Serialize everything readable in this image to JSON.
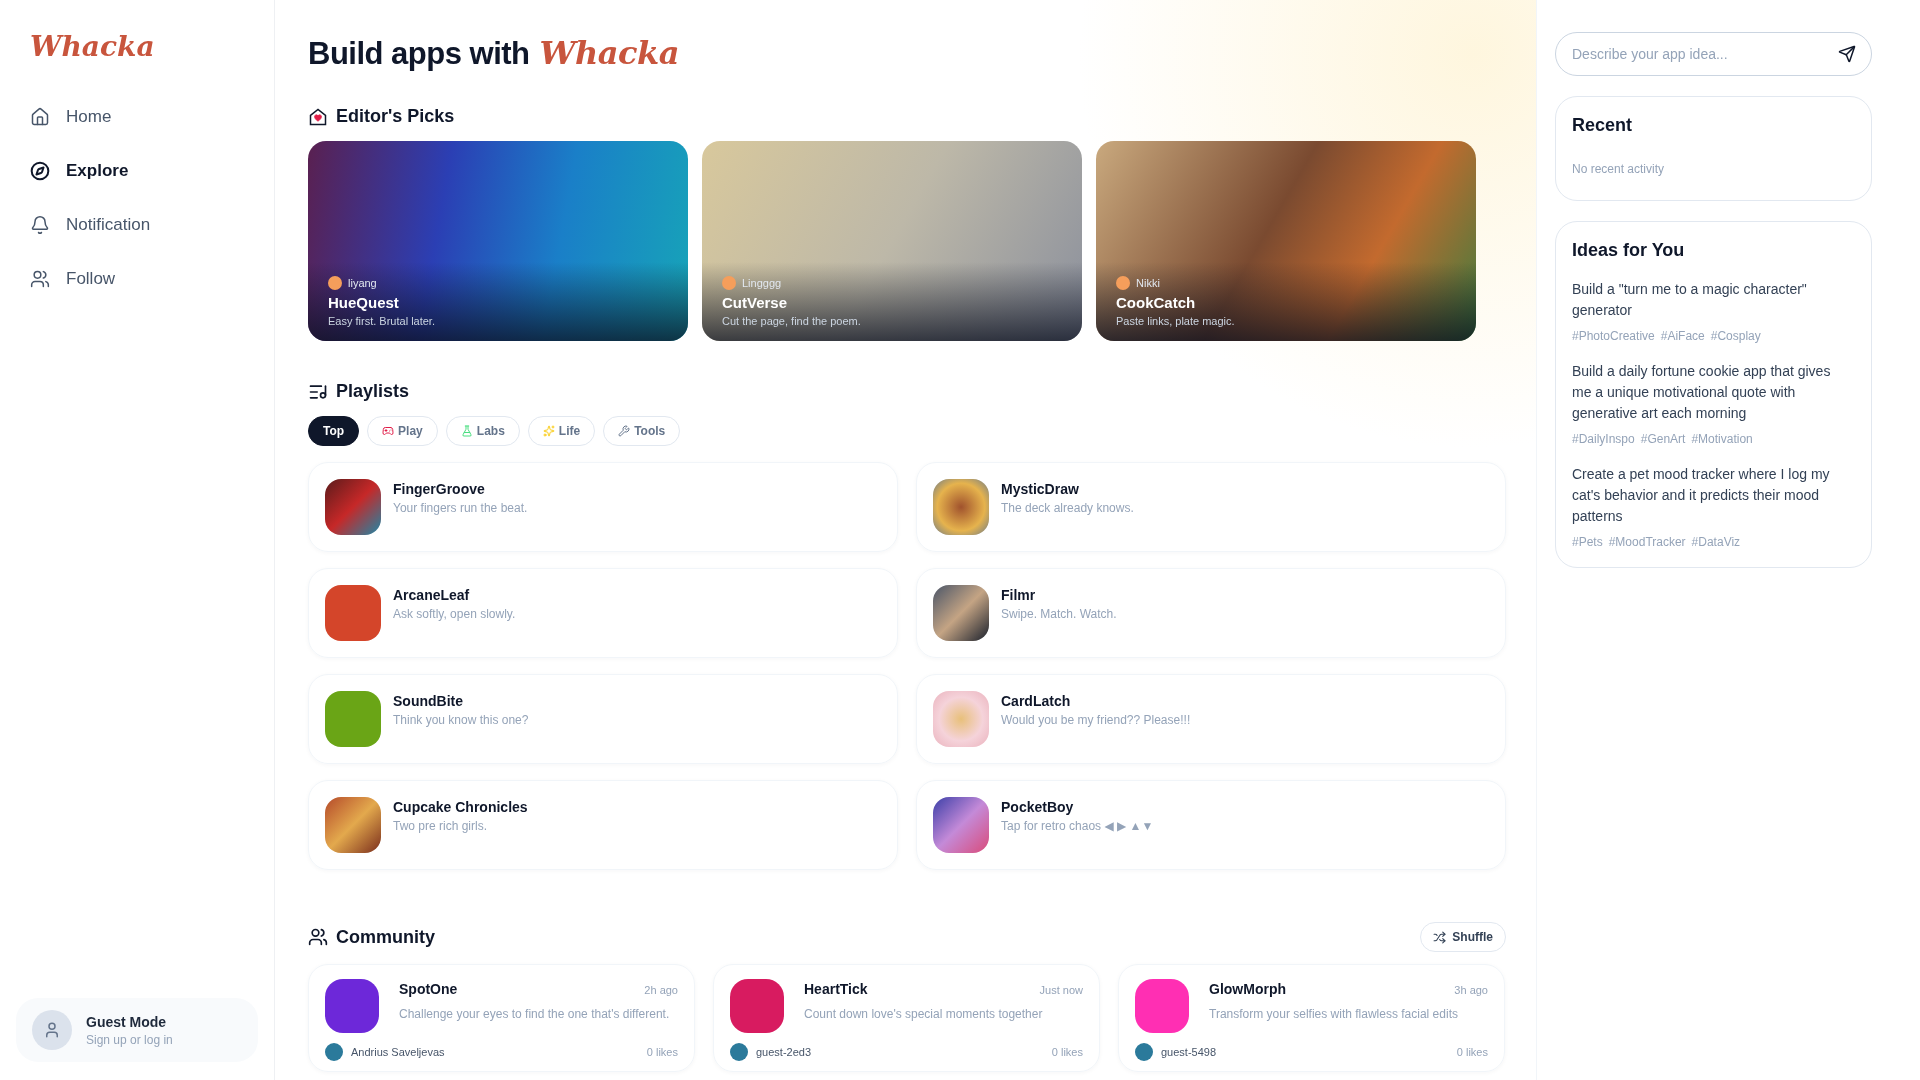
{
  "sidebar": {
    "logo": "Whacka",
    "items": [
      {
        "label": "Home",
        "selected": false
      },
      {
        "label": "Explore",
        "selected": true
      },
      {
        "label": "Notification",
        "selected": false
      },
      {
        "label": "Follow",
        "selected": false
      }
    ],
    "account": {
      "name": "Guest Mode",
      "hint": "Sign up or log in"
    }
  },
  "header": {
    "title": "Build apps with",
    "brand": "Whacka"
  },
  "editors_picks": {
    "title": "Editor's Picks",
    "cards": [
      {
        "author": "liyang",
        "name": "HueQuest",
        "tagline": "Easy first. Brutal later."
      },
      {
        "author": "Lingggg",
        "name": "CutVerse",
        "tagline": "Cut the page, find the poem."
      },
      {
        "author": "Nikki",
        "name": "CookCatch",
        "tagline": "Paste links, plate magic."
      }
    ]
  },
  "playlists": {
    "title": "Playlists",
    "tabs": [
      {
        "label": "Top",
        "selected": true
      },
      {
        "label": "Play",
        "selected": false
      },
      {
        "label": "Labs",
        "selected": false
      },
      {
        "label": "Life",
        "selected": false
      },
      {
        "label": "Tools",
        "selected": false
      }
    ],
    "apps": [
      {
        "name": "FingerGroove",
        "tagline": "Your fingers run the beat."
      },
      {
        "name": "MysticDraw",
        "tagline": "The deck already knows."
      },
      {
        "name": "ArcaneLeaf",
        "tagline": "Ask softly, open slowly."
      },
      {
        "name": "Filmr",
        "tagline": "Swipe. Match. Watch."
      },
      {
        "name": "SoundBite",
        "tagline": "Think you know this one?"
      },
      {
        "name": "CardLatch",
        "tagline": "Would you be my friend?? Please!!!"
      },
      {
        "name": "Cupcake Chronicles",
        "tagline": "Two pre rich girls."
      },
      {
        "name": "PocketBoy",
        "tagline": "Tap for retro chaos ◀ ▶ ▲▼"
      }
    ]
  },
  "community": {
    "title": "Community",
    "shuffle": "Shuffle",
    "cards": [
      {
        "name": "SpotOne",
        "time": "2h ago",
        "description": "Challenge your eyes to find the one that's different.",
        "author": "Andrius Saveljevas",
        "likes": "0 likes",
        "color": "#6d28d9"
      },
      {
        "name": "HeartTick",
        "time": "Just now",
        "description": "Count down love's special moments together",
        "author": "guest-2ed3",
        "likes": "0 likes",
        "color": "#d81b60"
      },
      {
        "name": "GlowMorph",
        "time": "3h ago",
        "description": "Transform your selfies with flawless facial edits",
        "author": "guest-5498",
        "likes": "0 likes",
        "color": "#ff2fb3"
      }
    ]
  },
  "right_panel": {
    "search": {
      "placeholder": "Describe your app idea..."
    },
    "recent": {
      "title": "Recent",
      "empty": "No recent activity"
    },
    "ideas": {
      "title": "Ideas for You",
      "items": [
        {
          "text": "Build a \"turn me to a magic character\" generator",
          "tags": [
            "#PhotoCreative",
            "#AiFace",
            "#Cosplay"
          ]
        },
        {
          "text": "Build a daily fortune cookie app that gives me a unique motivational quote with generative art each morning",
          "tags": [
            "#DailyInspo",
            "#GenArt",
            "#Motivation"
          ]
        },
        {
          "text": "Create a pet mood tracker where I log my cat's behavior and it predicts their mood patterns",
          "tags": [
            "#Pets",
            "#MoodTracker",
            "#DataViz"
          ]
        }
      ]
    }
  }
}
